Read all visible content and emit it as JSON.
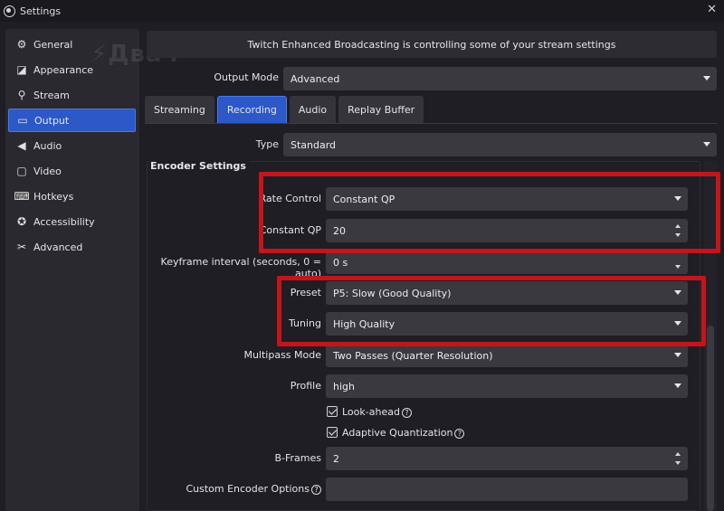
{
  "window": {
    "title": "Settings",
    "close": "✕"
  },
  "watermark": "⚡Двач",
  "sidebar": {
    "items": [
      {
        "label": "General",
        "icon": "⚙"
      },
      {
        "label": "Appearance",
        "icon": "◪"
      },
      {
        "label": "Stream",
        "icon": "⚲"
      },
      {
        "label": "Output",
        "icon": "▭"
      },
      {
        "label": "Audio",
        "icon": "◀"
      },
      {
        "label": "Video",
        "icon": "▢"
      },
      {
        "label": "Hotkeys",
        "icon": "⌨"
      },
      {
        "label": "Accessibility",
        "icon": "✪"
      },
      {
        "label": "Advanced",
        "icon": "✂"
      }
    ],
    "active": "Output"
  },
  "banner": "Twitch Enhanced Broadcasting is controlling some of your stream settings",
  "output_mode": {
    "label": "Output Mode",
    "value": "Advanced"
  },
  "tabs": [
    "Streaming",
    "Recording",
    "Audio",
    "Replay Buffer"
  ],
  "active_tab": "Recording",
  "type": {
    "label": "Type",
    "value": "Standard"
  },
  "encoder": {
    "title": "Encoder Settings",
    "rate_control": {
      "label": "Rate Control",
      "value": "Constant QP"
    },
    "constant_qp": {
      "label": "Constant QP",
      "value": "20"
    },
    "keyframe": {
      "label": "Keyframe interval (seconds, 0 = auto)",
      "value": "0 s"
    },
    "preset": {
      "label": "Preset",
      "value": "P5: Slow (Good Quality)"
    },
    "tuning": {
      "label": "Tuning",
      "value": "High Quality"
    },
    "multipass": {
      "label": "Multipass Mode",
      "value": "Two Passes (Quarter Resolution)"
    },
    "profile": {
      "label": "Profile",
      "value": "high"
    },
    "look_ahead": {
      "label": "Look-ahead",
      "checked": true
    },
    "adaptive_quant": {
      "label": "Adaptive Quantization",
      "checked": true
    },
    "bframes": {
      "label": "B-Frames",
      "value": "2"
    },
    "custom_options": {
      "label": "Custom Encoder Options",
      "value": ""
    }
  },
  "help_glyph": "?",
  "colors": {
    "accent": "#2c58c8",
    "highlight": "#c4151b",
    "panel": "#2a2930"
  }
}
